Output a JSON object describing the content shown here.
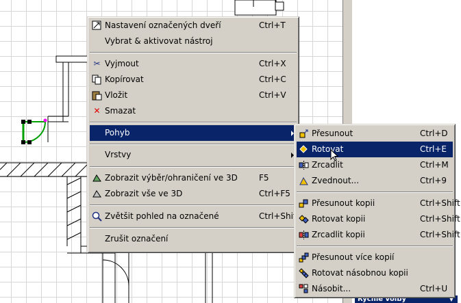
{
  "main_menu": {
    "items": [
      {
        "label": "Nastavení označených dveří",
        "shortcut": "Ctrl+T",
        "icon": "door-settings-icon"
      },
      {
        "label": "Vybrat & aktivovat nástroj",
        "shortcut": "",
        "icon": ""
      },
      {
        "label": "Vyjmout",
        "shortcut": "Ctrl+X",
        "icon": "scissors-icon"
      },
      {
        "label": "Kopírovat",
        "shortcut": "Ctrl+C",
        "icon": "copy-icon"
      },
      {
        "label": "Vložit",
        "shortcut": "Ctrl+V",
        "icon": "paste-icon"
      },
      {
        "label": "Smazat",
        "shortcut": "",
        "icon": "delete-x-icon"
      },
      {
        "label": "Pohyb",
        "shortcut": "",
        "icon": "",
        "submenu": true,
        "selected": true
      },
      {
        "label": "Vrstvy",
        "shortcut": "",
        "icon": "",
        "submenu": true
      },
      {
        "label": "Zobrazit výběr/ohraničení ve 3D",
        "shortcut": "F5",
        "icon": "show-selection-3d-icon"
      },
      {
        "label": "Zobrazit vše ve 3D",
        "shortcut": "Ctrl+F5",
        "icon": "show-all-3d-icon"
      },
      {
        "label": "Zvětšit pohled na označené",
        "shortcut": "Ctrl+Shift+'",
        "icon": "zoom-icon"
      },
      {
        "label": "Zrušit označení",
        "shortcut": "",
        "icon": ""
      }
    ]
  },
  "sub_menu": {
    "items": [
      {
        "label": "Přesunout",
        "shortcut": "Ctrl+D",
        "icon": "move-icon"
      },
      {
        "label": "Rotovat",
        "shortcut": "Ctrl+E",
        "icon": "rotate-icon",
        "selected": true
      },
      {
        "label": "Zrcadlit",
        "shortcut": "Ctrl+M",
        "icon": "mirror-icon"
      },
      {
        "label": "Zvednout...",
        "shortcut": "Ctrl+9",
        "icon": "elevate-icon"
      },
      {
        "label": "Přesunout kopii",
        "shortcut": "Ctrl+Shift+D",
        "icon": "move-copy-icon"
      },
      {
        "label": "Rotovat kopii",
        "shortcut": "Ctrl+Shift+E",
        "icon": "rotate-copy-icon"
      },
      {
        "label": "Zrcadlit kopii",
        "shortcut": "Ctrl+Shift+M",
        "icon": "mirror-copy-icon"
      },
      {
        "label": "Přesunout více kopií",
        "shortcut": "",
        "icon": "multi-move-icon"
      },
      {
        "label": "Rotovat násobnou kopii",
        "shortcut": "",
        "icon": "multi-rotate-icon"
      },
      {
        "label": "Násobit...",
        "shortcut": "Ctrl+U",
        "icon": "multiply-icon"
      }
    ]
  },
  "status": {
    "quick_options_label": "Rychlé volby"
  },
  "colors": {
    "menu_bg": "#d4d0c8",
    "highlight": "#0a246a",
    "selection_green": "#00a000",
    "grid": "#d6d6d6"
  }
}
